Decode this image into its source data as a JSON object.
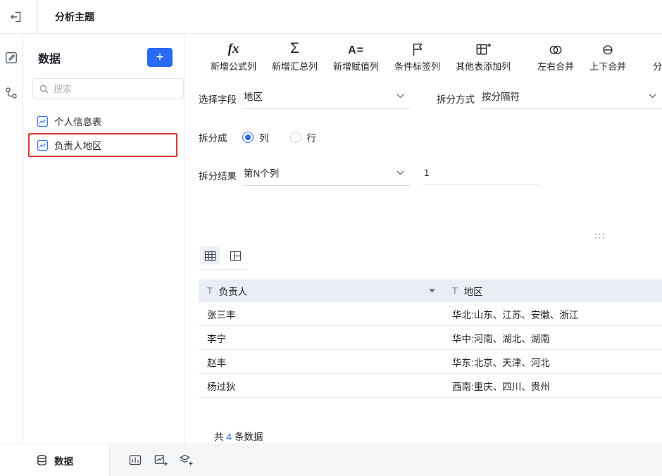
{
  "colors": {
    "accent": "#2a6af2",
    "selection_red": "#e0362c",
    "table_header_bg": "#e9edf4"
  },
  "topbar": {
    "title": "分析主题"
  },
  "sidebar": {
    "title": "数据",
    "add_button_glyph": "+",
    "search_placeholder": "搜索",
    "items": [
      {
        "label": "个人信息表",
        "selected": false
      },
      {
        "label": "负责人地区",
        "selected": true
      }
    ]
  },
  "toolbar": {
    "items": [
      {
        "icon": "fx-formula-icon",
        "glyph": "fx",
        "label": "新增公式列"
      },
      {
        "icon": "sigma-icon",
        "glyph": "Σ",
        "label": "新增汇总列"
      },
      {
        "icon": "assign-icon",
        "glyph": "A=",
        "label": "新增赋值列"
      },
      {
        "icon": "flag-icon",
        "label": "条件标签列"
      },
      {
        "icon": "table-add-icon",
        "label": "其他表添加列"
      },
      {
        "icon": "merge-lr-icon",
        "label": "左右合并"
      },
      {
        "icon": "merge-tb-icon",
        "label": "上下合并"
      },
      {
        "icon": "group-summary-icon",
        "label": "分组汇总"
      }
    ]
  },
  "form": {
    "field_label": "选择字段",
    "field_value": "地区",
    "method_label": "拆分方式",
    "method_value": "按分隔符",
    "split_label": "拆分成",
    "option_col": "列",
    "option_row": "行",
    "result_label": "拆分结果",
    "result_value": "第N个列",
    "result_n": "1"
  },
  "table": {
    "type_glyph": "T",
    "columns": [
      "负责人",
      "地区"
    ],
    "rows": [
      [
        "张三丰",
        "华北:山东、江苏、安徽、浙江"
      ],
      [
        "李宁",
        "华中:河南、湖北、湖南"
      ],
      [
        "赵丰",
        "华东:北京、天津、河北"
      ],
      [
        "杨过狄",
        "西南:重庆、四川、贵州"
      ]
    ],
    "footer": {
      "prefix": "共",
      "count": "4",
      "suffix": "条数据"
    }
  },
  "bottombar": {
    "active_tab": "数据"
  }
}
